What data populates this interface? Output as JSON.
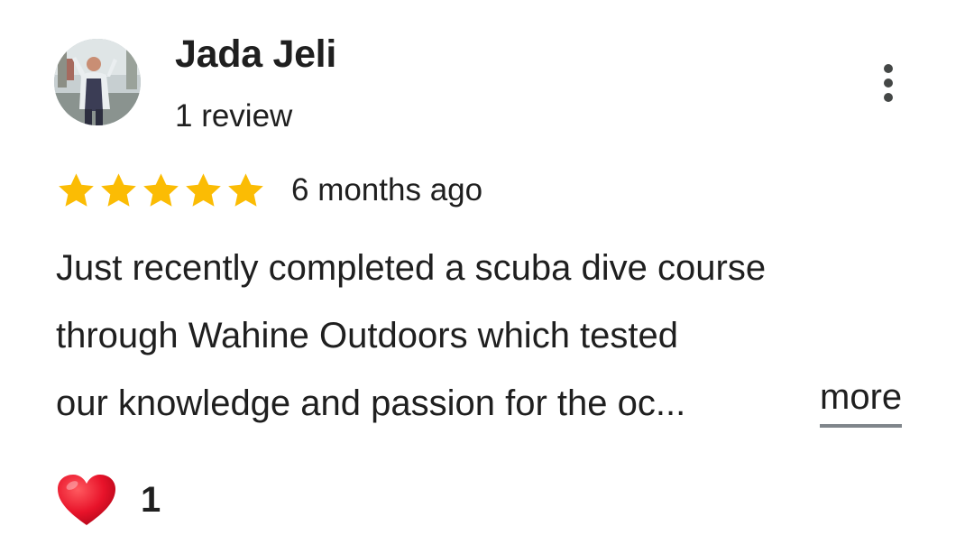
{
  "reviewer": {
    "name": "Jada Jeli",
    "review_count": "1 review"
  },
  "rating": {
    "stars": 5,
    "max_stars": 5,
    "star_color": "#fbbc04",
    "date": "6 months ago"
  },
  "review": {
    "lines": [
      "Just recently completed a scuba dive course",
      "through Wahine Outdoors which tested",
      "our knowledge and passion for the oc..."
    ],
    "more_label": "more"
  },
  "reactions": {
    "icon": "heart-icon",
    "count": "1"
  },
  "menu": {
    "icon": "more-vert-icon"
  }
}
